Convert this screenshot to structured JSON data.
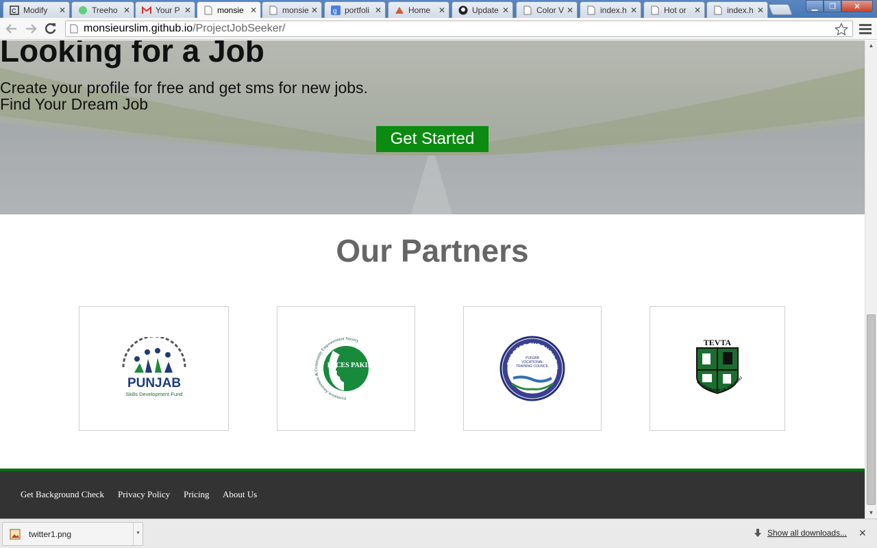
{
  "browser": {
    "tabs": [
      {
        "title": "Modify",
        "icon": "codepen-icon",
        "active": false
      },
      {
        "title": "Treeho",
        "icon": "treehouse-icon",
        "active": false
      },
      {
        "title": "Your P",
        "icon": "gmail-icon",
        "active": false
      },
      {
        "title": "monsie",
        "icon": "page-icon",
        "active": true
      },
      {
        "title": "monsie",
        "icon": "page-icon",
        "active": false
      },
      {
        "title": "portfoli",
        "icon": "google-icon",
        "active": false
      },
      {
        "title": "Home",
        "icon": "site-icon",
        "active": false
      },
      {
        "title": "Update",
        "icon": "github-icon",
        "active": false
      },
      {
        "title": "Color V",
        "icon": "page-icon",
        "active": false
      },
      {
        "title": "index.h",
        "icon": "page-icon",
        "active": false
      },
      {
        "title": "Hot or",
        "icon": "page-icon",
        "active": false
      },
      {
        "title": "index.h",
        "icon": "page-icon",
        "active": false
      }
    ],
    "url_host": "monsieurslim.github.io",
    "url_path": "/ProjectJobSeeker/"
  },
  "hero": {
    "title": "Looking for a Job",
    "line1": "Create your profile for free and get sms for new jobs.",
    "line2": "Find Your Dream Job",
    "cta_label": "Get Started"
  },
  "partners": {
    "title": "Our Partners",
    "logos": [
      {
        "name": "PUNJAB",
        "tagline": "Skills Development Fund"
      },
      {
        "name": "FACES PAKISTAN",
        "tagline": "Formation Awareness & Community Empowerment Society"
      },
      {
        "name": "SUCCESS THROUGH SKILL",
        "tagline": "PUNJAB VOCATIONAL TRAINING COUNCIL"
      },
      {
        "name": "TEVTA",
        "tagline": "GOVERNMENT OF THE PUNJAB"
      }
    ]
  },
  "footer": {
    "links": [
      "Get Background Check",
      "Privacy Policy",
      "Pricing",
      "About Us"
    ]
  },
  "downloads": {
    "file_name": "twitter1.png",
    "show_all_label": "Show all downloads..."
  },
  "colors": {
    "cta": "#0b8b10",
    "footer_bg": "#333333",
    "footer_accent": "#0e6b14",
    "partners_title": "#666666"
  }
}
